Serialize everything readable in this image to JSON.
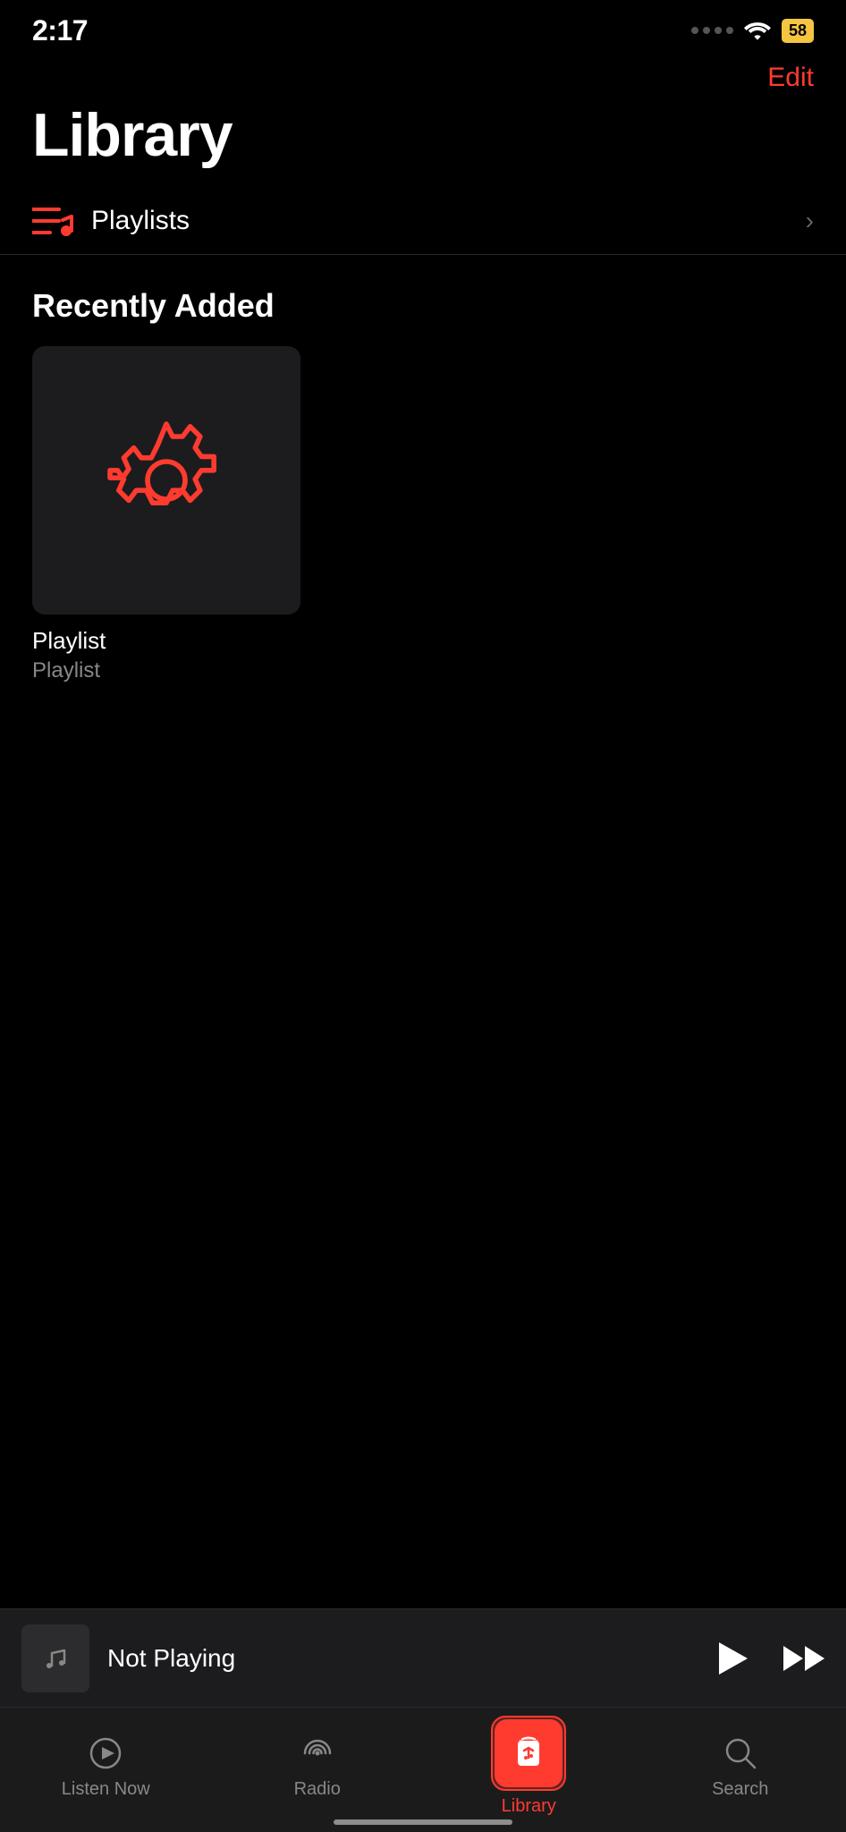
{
  "status_bar": {
    "time": "2:17",
    "battery": "58"
  },
  "header": {
    "edit_label": "Edit"
  },
  "page": {
    "title": "Library"
  },
  "playlists": {
    "label": "Playlists"
  },
  "recently_added": {
    "section_label": "Recently Added",
    "items": [
      {
        "title": "Playlist",
        "subtitle": "Playlist"
      }
    ]
  },
  "mini_player": {
    "title": "Not Playing"
  },
  "tab_bar": {
    "items": [
      {
        "id": "listen-now",
        "label": "Listen Now",
        "active": false
      },
      {
        "id": "radio",
        "label": "Radio",
        "active": false
      },
      {
        "id": "library",
        "label": "Library",
        "active": true
      },
      {
        "id": "search",
        "label": "Search",
        "active": false
      }
    ]
  }
}
